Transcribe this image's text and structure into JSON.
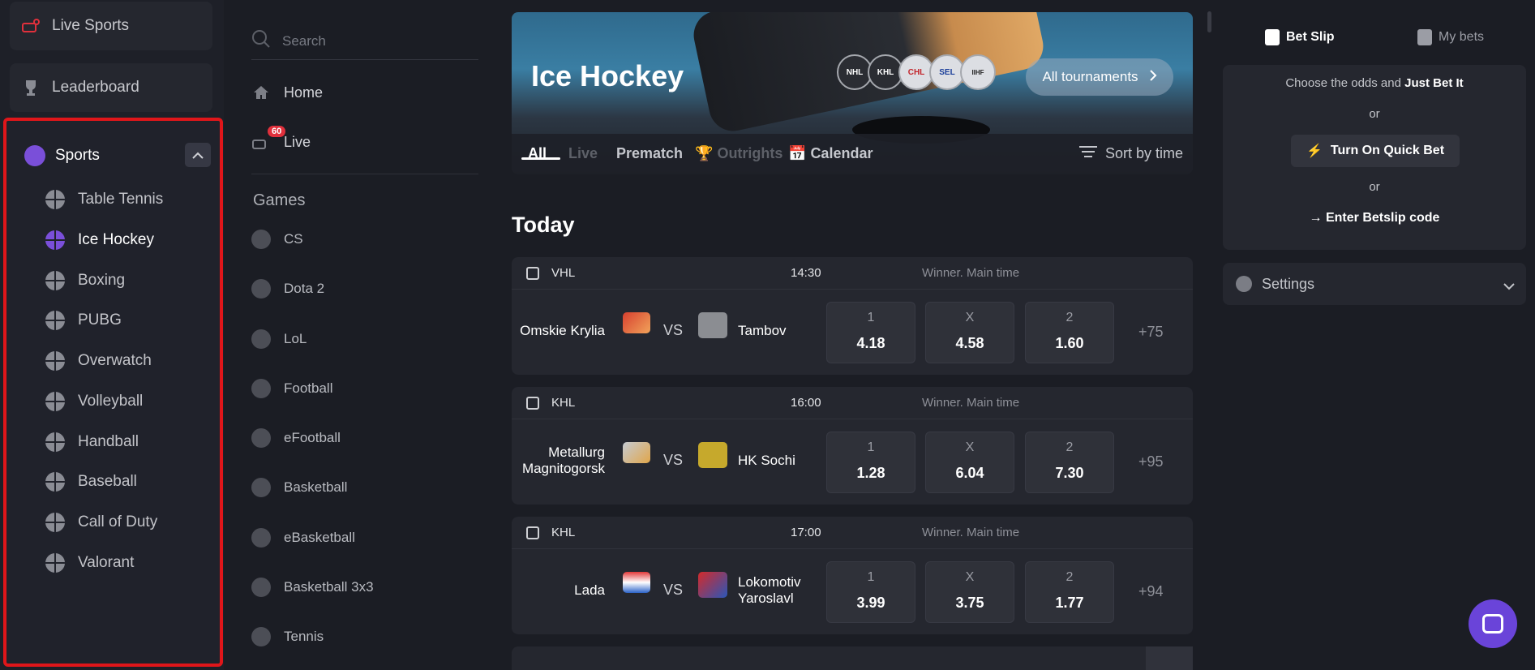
{
  "sidebar": {
    "live_sports": "Live Sports",
    "leaderboard": "Leaderboard",
    "sports": {
      "label": "Sports",
      "items": [
        "Table Tennis",
        "Ice Hockey",
        "Boxing",
        "PUBG",
        "Overwatch",
        "Volleyball",
        "Handball",
        "Baseball",
        "Call of Duty",
        "Valorant"
      ],
      "active": "Ice Hockey"
    }
  },
  "nav": {
    "search_placeholder": "Search",
    "home": "Home",
    "live": "Live",
    "live_count": "60",
    "games_heading": "Games",
    "games": [
      "CS",
      "Dota 2",
      "LoL",
      "Football",
      "eFootball",
      "Basketball",
      "eBasketball",
      "Basketball 3x3",
      "Tennis"
    ]
  },
  "banner": {
    "title": "Ice Hockey",
    "all_tournaments": "All tournaments",
    "leagues": [
      "NHL",
      "KHL",
      "CHL",
      "SEL",
      "IIHF"
    ]
  },
  "tabs": {
    "all": "All",
    "live": "Live",
    "prematch": "Prematch",
    "outrights": "Outrights",
    "calendar": "Calendar",
    "sort": "Sort by time"
  },
  "section": "Today",
  "matches": [
    {
      "league": "VHL",
      "time": "14:30",
      "market": "Winner. Main time",
      "team1": "Omskie Krylia",
      "team2": "Tambov",
      "vs": "VS",
      "odds": [
        {
          "l": "1",
          "v": "4.18"
        },
        {
          "l": "X",
          "v": "4.58"
        },
        {
          "l": "2",
          "v": "1.60"
        }
      ],
      "more": "+75"
    },
    {
      "league": "KHL",
      "time": "16:00",
      "market": "Winner. Main time",
      "team1": "Metallurg Magnitogorsk",
      "team2": "HK Sochi",
      "vs": "VS",
      "odds": [
        {
          "l": "1",
          "v": "1.28"
        },
        {
          "l": "X",
          "v": "6.04"
        },
        {
          "l": "2",
          "v": "7.30"
        }
      ],
      "more": "+95"
    },
    {
      "league": "KHL",
      "time": "17:00",
      "market": "Winner. Main time",
      "team1": "Lada",
      "team2": "Lokomotiv Yaroslavl",
      "vs": "VS",
      "odds": [
        {
          "l": "1",
          "v": "3.99"
        },
        {
          "l": "X",
          "v": "3.75"
        },
        {
          "l": "2",
          "v": "1.77"
        }
      ],
      "more": "+94"
    }
  ],
  "betslip": {
    "tab_slip": "Bet Slip",
    "tab_mybets": "My bets",
    "choose": "Choose the odds and",
    "just_bet_it": "Just Bet It",
    "or": "or",
    "quick_bet": "Turn On Quick Bet",
    "enter_code": "→ Enter Betslip code",
    "settings": "Settings"
  },
  "colors": {
    "accent": "#7a4fd9",
    "highlight_border": "#e0161a",
    "badge": "#e1303c",
    "bolt": "#f5b82e"
  }
}
